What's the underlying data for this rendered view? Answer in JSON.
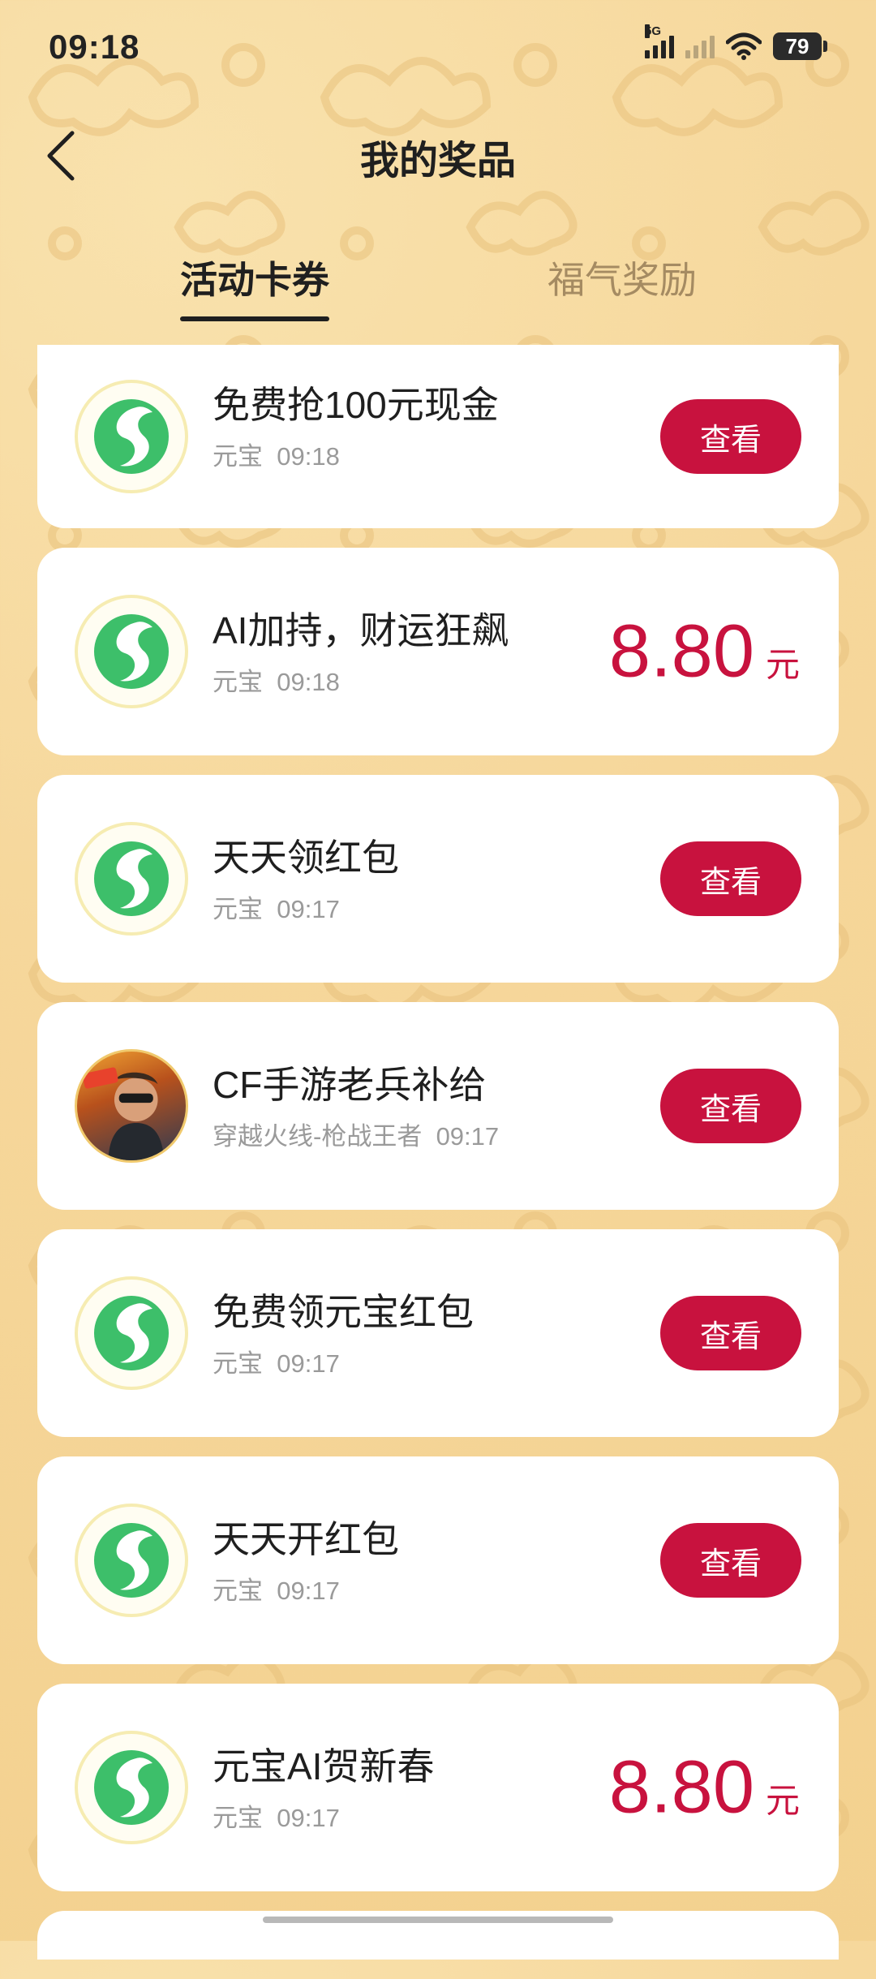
{
  "status_bar": {
    "time": "09:18",
    "network_label": "5G",
    "battery": "79"
  },
  "header": {
    "title": "我的奖品"
  },
  "tabs": [
    {
      "label": "活动卡券",
      "active": true
    },
    {
      "label": "福气奖励",
      "active": false
    }
  ],
  "prizes": [
    {
      "title": "免费抢100元现金",
      "source": "元宝",
      "time": "09:18",
      "action": "查看",
      "icon": "yuanbao-logo-icon"
    },
    {
      "title": "AI加持，财运狂飙",
      "source": "元宝",
      "time": "09:18",
      "amount": "8.80",
      "unit": "元",
      "icon": "yuanbao-logo-icon"
    },
    {
      "title": "天天领红包",
      "source": "元宝",
      "time": "09:17",
      "action": "查看",
      "icon": "yuanbao-logo-icon"
    },
    {
      "title": "CF手游老兵补给",
      "source": "穿越火线-枪战王者",
      "time": "09:17",
      "action": "查看",
      "icon": "cf-game-avatar-icon"
    },
    {
      "title": "免费领元宝红包",
      "source": "元宝",
      "time": "09:17",
      "action": "查看",
      "icon": "yuanbao-logo-icon"
    },
    {
      "title": "天天开红包",
      "source": "元宝",
      "time": "09:17",
      "action": "查看",
      "icon": "yuanbao-logo-icon"
    },
    {
      "title": "元宝AI贺新春",
      "source": "元宝",
      "time": "09:17",
      "amount": "8.80",
      "unit": "元",
      "icon": "yuanbao-logo-icon"
    }
  ],
  "colors": {
    "accent": "#c8123e",
    "background": "#f6d79b",
    "logo_green": "#3dbf6a"
  }
}
